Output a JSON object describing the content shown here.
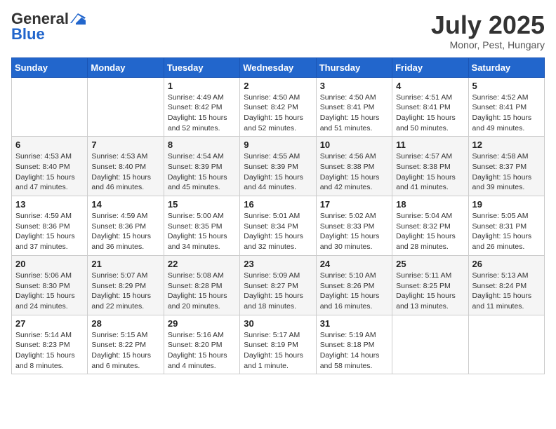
{
  "header": {
    "logo_general": "General",
    "logo_blue": "Blue",
    "month_title": "July 2025",
    "location": "Monor, Pest, Hungary"
  },
  "days_of_week": [
    "Sunday",
    "Monday",
    "Tuesday",
    "Wednesday",
    "Thursday",
    "Friday",
    "Saturday"
  ],
  "weeks": [
    [
      {
        "day": "",
        "info": ""
      },
      {
        "day": "",
        "info": ""
      },
      {
        "day": "1",
        "info": "Sunrise: 4:49 AM\nSunset: 8:42 PM\nDaylight: 15 hours and 52 minutes."
      },
      {
        "day": "2",
        "info": "Sunrise: 4:50 AM\nSunset: 8:42 PM\nDaylight: 15 hours and 52 minutes."
      },
      {
        "day": "3",
        "info": "Sunrise: 4:50 AM\nSunset: 8:41 PM\nDaylight: 15 hours and 51 minutes."
      },
      {
        "day": "4",
        "info": "Sunrise: 4:51 AM\nSunset: 8:41 PM\nDaylight: 15 hours and 50 minutes."
      },
      {
        "day": "5",
        "info": "Sunrise: 4:52 AM\nSunset: 8:41 PM\nDaylight: 15 hours and 49 minutes."
      }
    ],
    [
      {
        "day": "6",
        "info": "Sunrise: 4:53 AM\nSunset: 8:40 PM\nDaylight: 15 hours and 47 minutes."
      },
      {
        "day": "7",
        "info": "Sunrise: 4:53 AM\nSunset: 8:40 PM\nDaylight: 15 hours and 46 minutes."
      },
      {
        "day": "8",
        "info": "Sunrise: 4:54 AM\nSunset: 8:39 PM\nDaylight: 15 hours and 45 minutes."
      },
      {
        "day": "9",
        "info": "Sunrise: 4:55 AM\nSunset: 8:39 PM\nDaylight: 15 hours and 44 minutes."
      },
      {
        "day": "10",
        "info": "Sunrise: 4:56 AM\nSunset: 8:38 PM\nDaylight: 15 hours and 42 minutes."
      },
      {
        "day": "11",
        "info": "Sunrise: 4:57 AM\nSunset: 8:38 PM\nDaylight: 15 hours and 41 minutes."
      },
      {
        "day": "12",
        "info": "Sunrise: 4:58 AM\nSunset: 8:37 PM\nDaylight: 15 hours and 39 minutes."
      }
    ],
    [
      {
        "day": "13",
        "info": "Sunrise: 4:59 AM\nSunset: 8:36 PM\nDaylight: 15 hours and 37 minutes."
      },
      {
        "day": "14",
        "info": "Sunrise: 4:59 AM\nSunset: 8:36 PM\nDaylight: 15 hours and 36 minutes."
      },
      {
        "day": "15",
        "info": "Sunrise: 5:00 AM\nSunset: 8:35 PM\nDaylight: 15 hours and 34 minutes."
      },
      {
        "day": "16",
        "info": "Sunrise: 5:01 AM\nSunset: 8:34 PM\nDaylight: 15 hours and 32 minutes."
      },
      {
        "day": "17",
        "info": "Sunrise: 5:02 AM\nSunset: 8:33 PM\nDaylight: 15 hours and 30 minutes."
      },
      {
        "day": "18",
        "info": "Sunrise: 5:04 AM\nSunset: 8:32 PM\nDaylight: 15 hours and 28 minutes."
      },
      {
        "day": "19",
        "info": "Sunrise: 5:05 AM\nSunset: 8:31 PM\nDaylight: 15 hours and 26 minutes."
      }
    ],
    [
      {
        "day": "20",
        "info": "Sunrise: 5:06 AM\nSunset: 8:30 PM\nDaylight: 15 hours and 24 minutes."
      },
      {
        "day": "21",
        "info": "Sunrise: 5:07 AM\nSunset: 8:29 PM\nDaylight: 15 hours and 22 minutes."
      },
      {
        "day": "22",
        "info": "Sunrise: 5:08 AM\nSunset: 8:28 PM\nDaylight: 15 hours and 20 minutes."
      },
      {
        "day": "23",
        "info": "Sunrise: 5:09 AM\nSunset: 8:27 PM\nDaylight: 15 hours and 18 minutes."
      },
      {
        "day": "24",
        "info": "Sunrise: 5:10 AM\nSunset: 8:26 PM\nDaylight: 15 hours and 16 minutes."
      },
      {
        "day": "25",
        "info": "Sunrise: 5:11 AM\nSunset: 8:25 PM\nDaylight: 15 hours and 13 minutes."
      },
      {
        "day": "26",
        "info": "Sunrise: 5:13 AM\nSunset: 8:24 PM\nDaylight: 15 hours and 11 minutes."
      }
    ],
    [
      {
        "day": "27",
        "info": "Sunrise: 5:14 AM\nSunset: 8:23 PM\nDaylight: 15 hours and 8 minutes."
      },
      {
        "day": "28",
        "info": "Sunrise: 5:15 AM\nSunset: 8:22 PM\nDaylight: 15 hours and 6 minutes."
      },
      {
        "day": "29",
        "info": "Sunrise: 5:16 AM\nSunset: 8:20 PM\nDaylight: 15 hours and 4 minutes."
      },
      {
        "day": "30",
        "info": "Sunrise: 5:17 AM\nSunset: 8:19 PM\nDaylight: 15 hours and 1 minute."
      },
      {
        "day": "31",
        "info": "Sunrise: 5:19 AM\nSunset: 8:18 PM\nDaylight: 14 hours and 58 minutes."
      },
      {
        "day": "",
        "info": ""
      },
      {
        "day": "",
        "info": ""
      }
    ]
  ]
}
